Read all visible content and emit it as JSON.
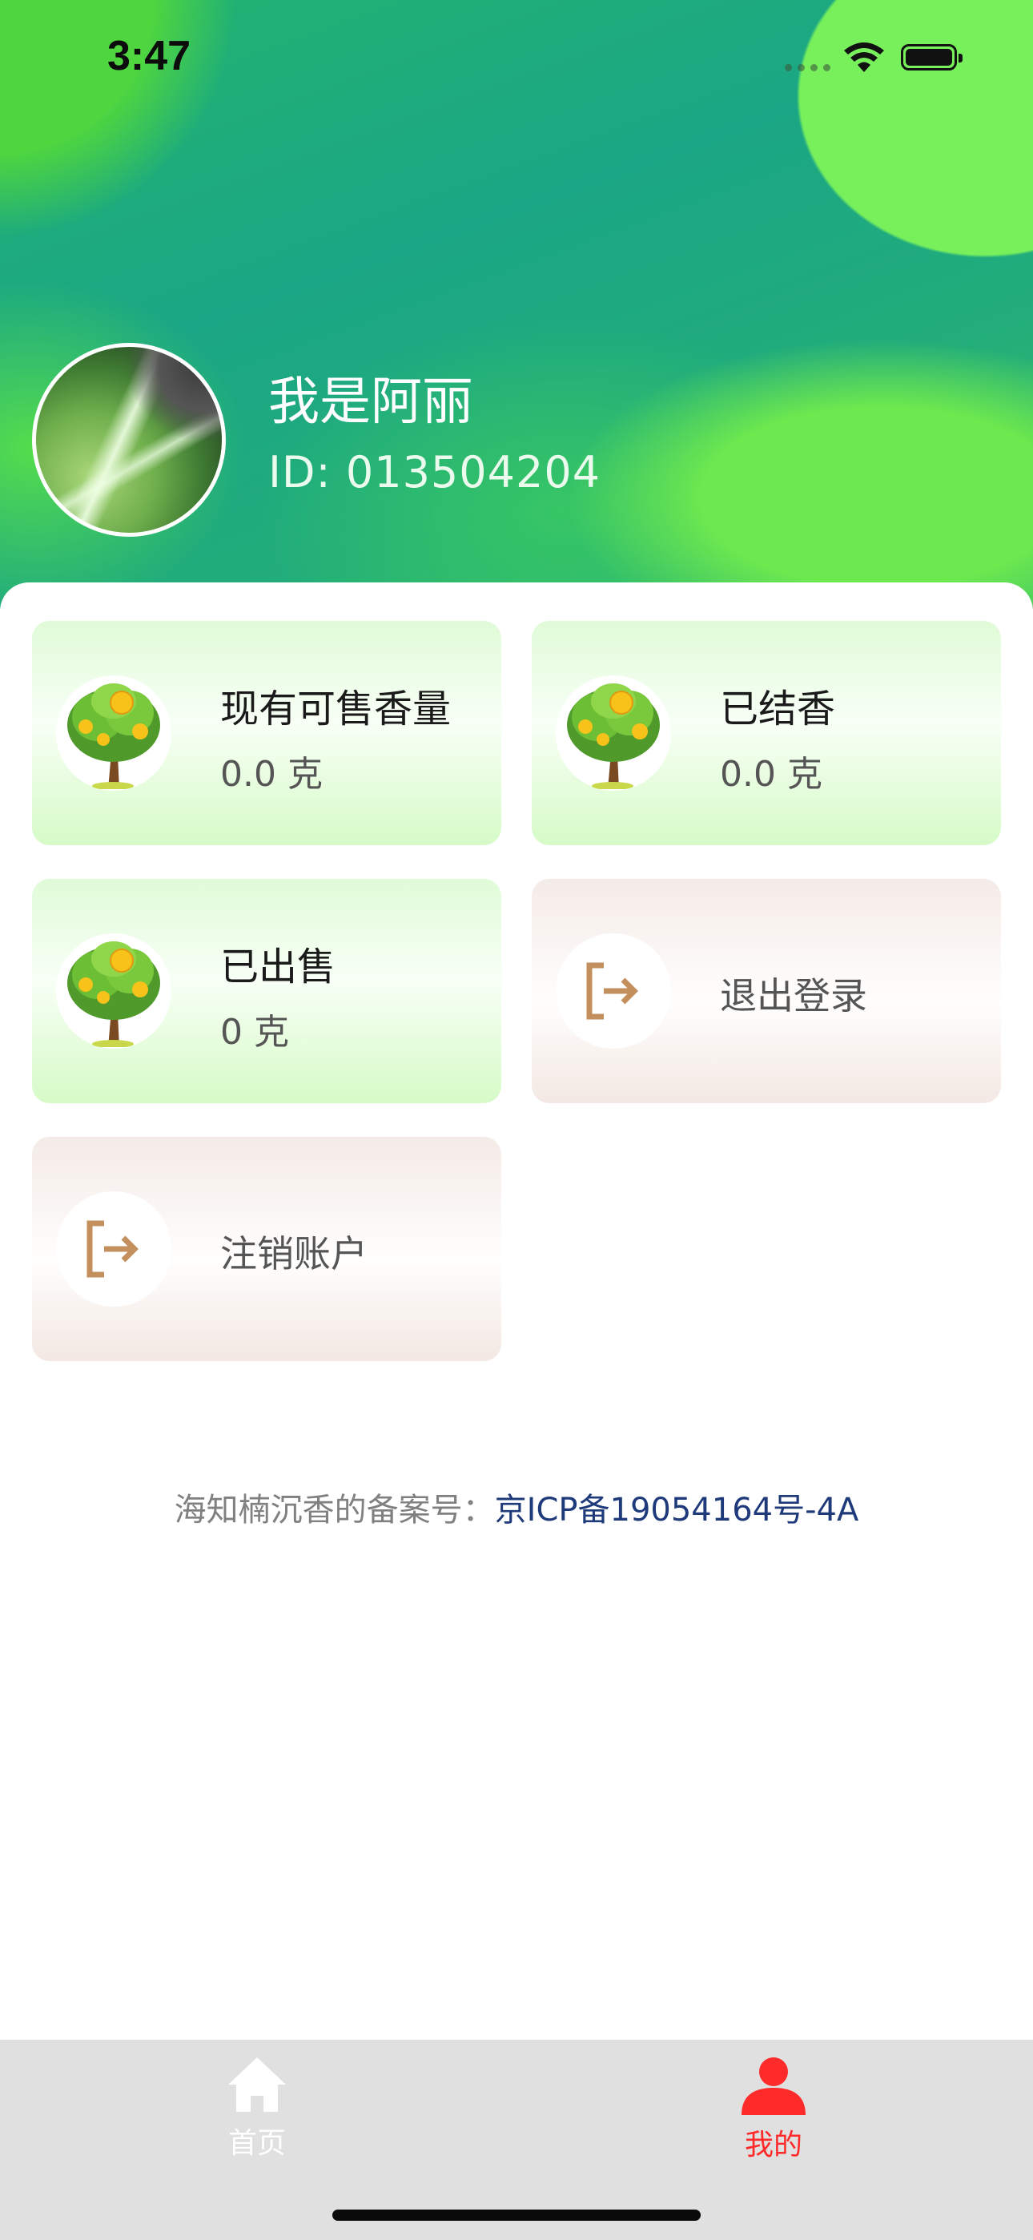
{
  "status_bar": {
    "time": "3:47"
  },
  "profile": {
    "name": "我是阿丽",
    "id_text": "ID: 013504204"
  },
  "cards": [
    {
      "title": "现有可售香量",
      "value": "0.0 克",
      "icon": "money-tree-icon"
    },
    {
      "title": "已结香",
      "value": "0.0 克",
      "icon": "money-tree-icon"
    },
    {
      "title": "已出售",
      "value": "0 克",
      "icon": "money-tree-icon"
    },
    {
      "title": "退出登录",
      "icon": "logout-icon"
    },
    {
      "title": "注销账户",
      "icon": "logout-icon"
    }
  ],
  "icp": {
    "label": "海知楠沉香的备案号：",
    "number": "京ICP备19054164号-4A"
  },
  "tabbar": {
    "home": {
      "label": "首页",
      "icon": "home-icon"
    },
    "mine": {
      "label": "我的",
      "icon": "user-icon",
      "active": true
    }
  },
  "colors": {
    "active_tab": "#ff2a2a",
    "inactive_tab": "#ffffff",
    "icp_link": "#1f3a7a",
    "logout_icon": "#c38f5c"
  }
}
